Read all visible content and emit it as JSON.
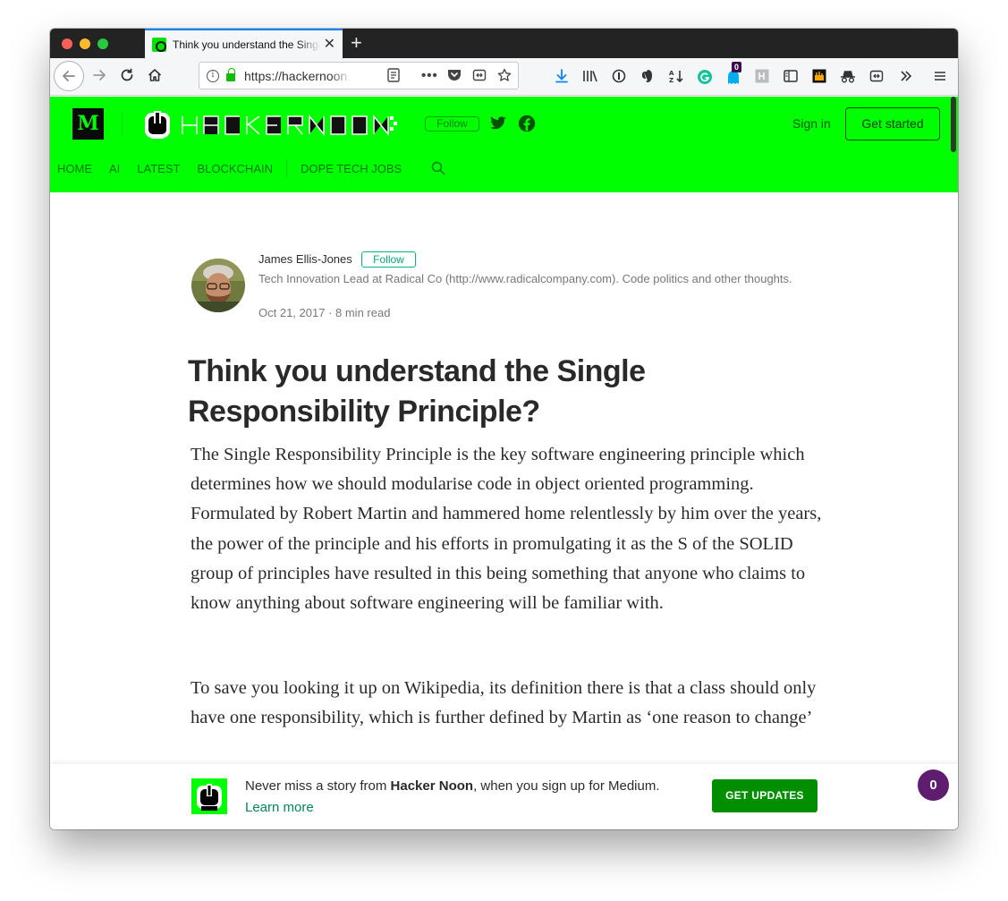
{
  "browser": {
    "tab_title": "Think you understand the Single Responsibility Principle? – Hacker Noon",
    "tab_close": "✕",
    "new_tab": "+",
    "url": "https://hackernoon.com/think-you-understand-the-single-responsibility-principle",
    "ghostery_count": "0"
  },
  "site": {
    "brand_letter": "M",
    "follow_label": "Follow",
    "signin_label": "Sign in",
    "getstarted_label": "Get started",
    "nav": [
      "HOME",
      "AI",
      "LATEST",
      "BLOCKCHAIN",
      "DOPE TECH JOBS"
    ],
    "accent": "#00ff00"
  },
  "author": {
    "name": "James Ellis-Jones",
    "follow_label": "Follow",
    "bio": "Tech Innovation Lead at Radical Co (http://www.radicalcompany.com). Code politics and other thoughts.",
    "date": "Oct 21, 2017",
    "read_time": "8 min read",
    "meta_sep": " · "
  },
  "article": {
    "title": "Think you understand the Single Responsibility Principle?",
    "p1": "The Single Responsibility Principle is the key software engineering principle which determines how we should modularise code in object oriented programming. Formulated by Robert Martin and hammered home relentlessly by him over the years, the power of the principle and his efforts in promulgating it as the S of the SOLID group of principles have resulted in this being something that anyone who claims to know anything about software engineering will be familiar with.",
    "p2": "To save you looking it up on Wikipedia, its definition there is that a class should only have one responsibility, which is further defined by Martin as ‘one reason to change’"
  },
  "banner": {
    "text_before": "Never miss a story from ",
    "publication": "Hacker Noon",
    "text_after": ", when you sign up for Medium. ",
    "learn_more": "Learn more",
    "button_label": "GET UPDATES",
    "clap_count": "0"
  }
}
